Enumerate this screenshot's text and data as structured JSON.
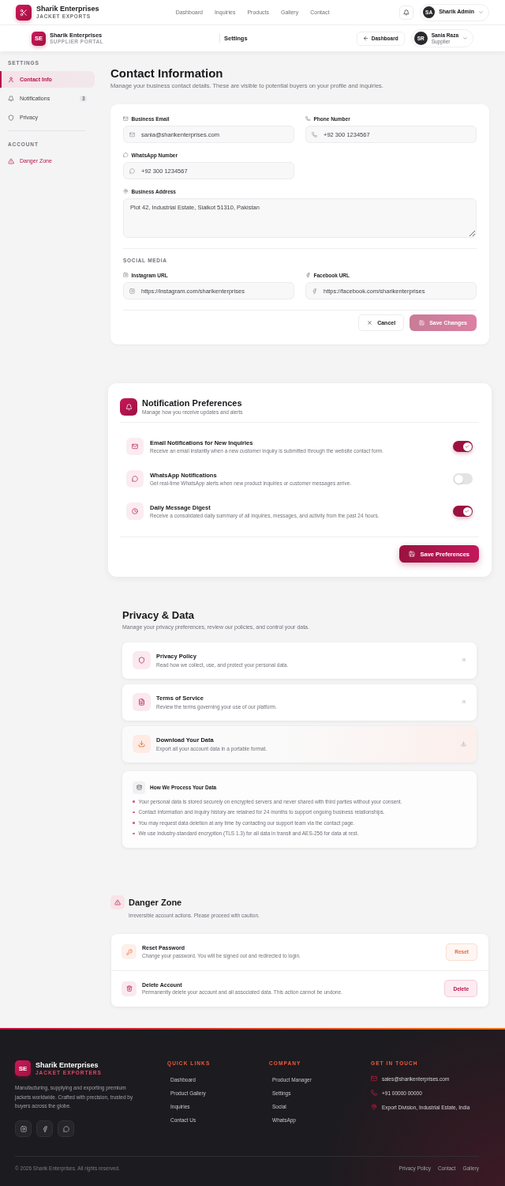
{
  "top_nav": {
    "brand_name": "Sharik Enterprises",
    "brand_tagline": "JACKET EXPORTS",
    "links": [
      {
        "label": "Dashboard",
        "selected": false
      },
      {
        "label": "Inquiries",
        "selected": false
      },
      {
        "label": "Products",
        "selected": false
      },
      {
        "label": "Gallery",
        "selected": false
      },
      {
        "label": "Contact",
        "selected": false
      }
    ],
    "user": {
      "initials": "SA",
      "name": "Sharik Admin"
    }
  },
  "portal_header": {
    "brand_initials": "SE",
    "brand_name": "Sharik Enterprises",
    "brand_tagline": "SUPPLIER PORTAL",
    "title": "Settings",
    "back_button": "Dashboard",
    "user": {
      "initials": "SR",
      "name": "Sania Raza",
      "role": "Supplier"
    }
  },
  "sidebar": {
    "sections": [
      {
        "title": "SETTINGS",
        "items": [
          {
            "label": "Contact Info",
            "kind": "link",
            "selected": true
          },
          {
            "label": "Notifications",
            "kind": "link",
            "selected": false,
            "badge": "3"
          },
          {
            "label": "Privacy",
            "kind": "link",
            "selected": false
          }
        ]
      },
      {
        "title": "ACCOUNT",
        "items": [
          {
            "label": "Danger Zone",
            "kind": "danger",
            "selected": false
          }
        ]
      }
    ]
  },
  "contact": {
    "title": "Contact Information",
    "subtitle": "Manage your business contact details. These are visible to potential buyers on your profile and inquiries.",
    "fields": [
      {
        "label": "Business Email",
        "kind": "text",
        "value": "sania@sharikenterprises.com"
      },
      {
        "label": "Phone Number",
        "kind": "text",
        "value": "+92 300 1234567"
      },
      {
        "label": "WhatsApp Number",
        "kind": "text",
        "value": "+92 300 1234567"
      },
      {
        "label": "Business Address",
        "kind": "textarea",
        "value": "Plot 42, Industrial Estate, Sialkot 51310, Pakistan"
      }
    ],
    "social": {
      "title": "SOCIAL MEDIA",
      "fields": [
        {
          "label": "Instagram URL",
          "value": "https://instagram.com/sharikenterprises"
        },
        {
          "label": "Facebook URL",
          "value": "https://facebook.com/sharikenterprises"
        }
      ]
    },
    "actions": {
      "cancel": "Cancel",
      "save": {
        "label": "Save Changes",
        "disabled": true
      }
    }
  },
  "notifications": {
    "title": "Notification Preferences",
    "subtitle": "Manage how you receive updates and alerts",
    "items": [
      {
        "title": "Email Notifications for New Inquiries",
        "description": "Receive an email instantly when a new customer inquiry is submitted through the website contact form.",
        "on": true
      },
      {
        "title": "WhatsApp Notifications",
        "description": "Get real-time WhatsApp alerts when new product inquiries or customer messages arrive.",
        "on": false
      },
      {
        "title": "Daily Message Digest",
        "description": "Receive a consolidated daily summary of all inquiries, messages, and activity from the past 24 hours.",
        "on": true
      }
    ],
    "save_button": "Save Preferences"
  },
  "privacy": {
    "title": "Privacy & Data",
    "subtitle": "Manage your privacy preferences, review our policies, and control your data.",
    "links": [
      {
        "title": "Privacy Policy",
        "description": "Read how we collect, use, and protect your personal data.",
        "kind": "link"
      },
      {
        "title": "Terms of Service",
        "description": "Review the terms governing your use of our platform.",
        "kind": "link"
      },
      {
        "title": "Download Your Data",
        "description": "Export all your account data in a portable format.",
        "kind": "download"
      }
    ],
    "processing": {
      "title": "How We Process Your Data",
      "points": [
        "Your personal data is stored securely on encrypted servers and never shared with third parties without your consent.",
        "Contact information and inquiry history are retained for 24 months to support ongoing business relationships.",
        "You may request data deletion at any time by contacting our support team via the contact page.",
        "We use industry-standard encryption (TLS 1.3) for all data in transit and AES-256 for data at rest."
      ]
    }
  },
  "danger_zone": {
    "title": "Danger Zone",
    "subtitle": "Irreversible account actions. Please proceed with caution.",
    "actions": [
      {
        "title": "Reset Password",
        "description": "Change your password. You will be signed out and redirected to login.",
        "button": "Reset",
        "kind": "caution"
      },
      {
        "title": "Delete Account",
        "description": "Permanently delete your account and all associated data. This action cannot be undone.",
        "button": "Delete",
        "kind": "destructive"
      }
    ]
  },
  "footer": {
    "brand_initials": "SE",
    "brand_name": "Sharik Enterprises",
    "brand_tagline": "JACKET EXPORTERS",
    "description": "Manufacturing, supplying and exporting premium jackets worldwide. Crafted with precision, trusted by buyers across the globe.",
    "columns": [
      {
        "title": "QUICK LINKS",
        "links": [
          "Dashboard",
          "Product Gallery",
          "Inquiries",
          "Contact Us"
        ]
      },
      {
        "title": "COMPANY",
        "links": [
          "Product Manager",
          "Settings",
          "Social",
          "WhatsApp"
        ]
      }
    ],
    "contact": {
      "title": "GET IN TOUCH",
      "items": [
        "sales@sharikenterprises.com",
        "+91 00000 00000",
        "Export Division, Industrial Estate, India"
      ]
    },
    "copyright": "© 2026 Sharik Enterprises. All rights reserved.",
    "bottom_links": [
      "Privacy Policy",
      "Contact",
      "Gallery"
    ]
  }
}
